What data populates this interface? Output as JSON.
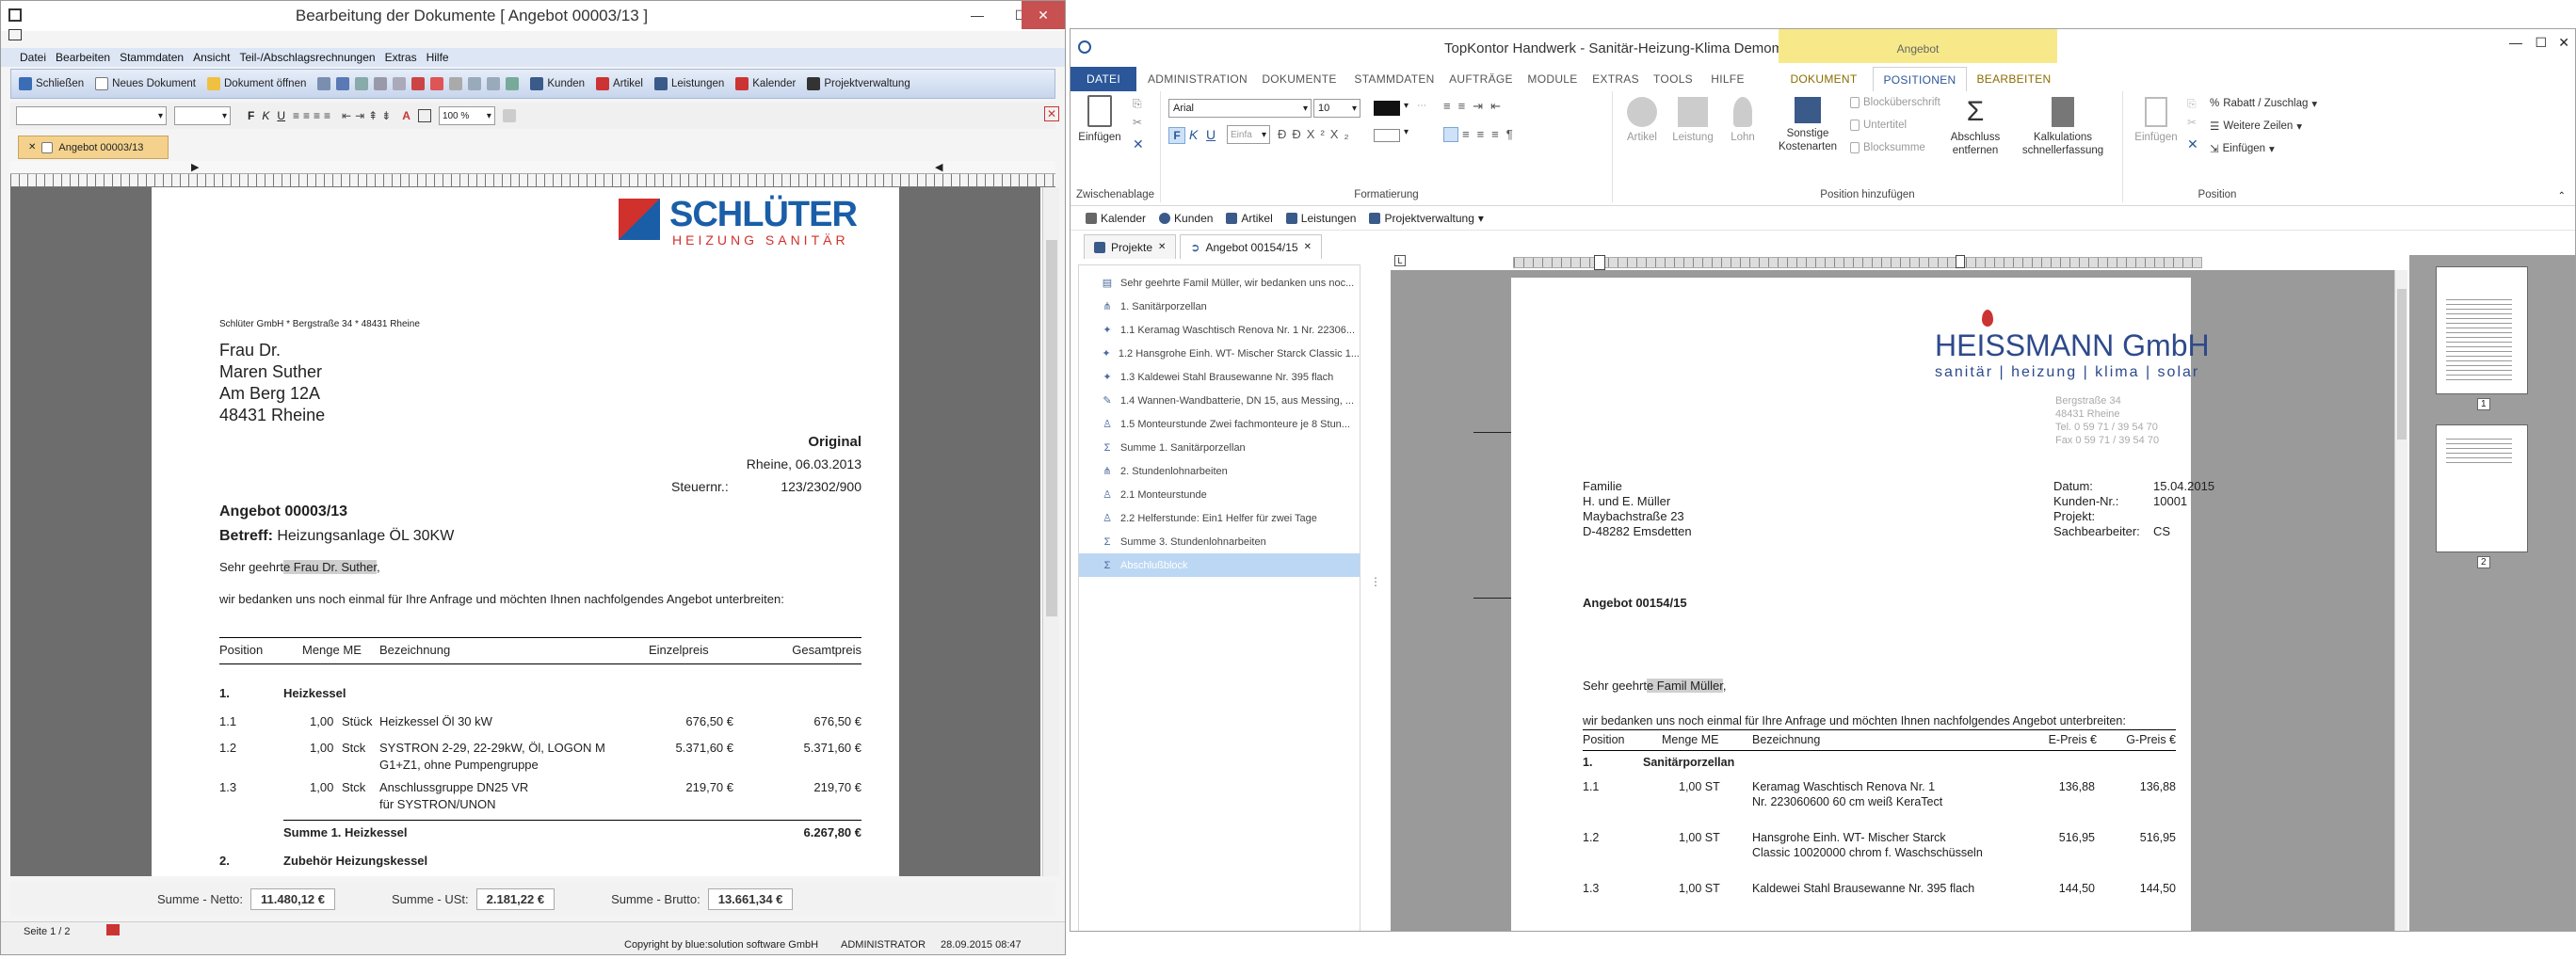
{
  "left_window": {
    "title": "Bearbeitung der Dokumente [ Angebot 00003/13 ]",
    "window_controls": {
      "minimize": "—",
      "maximize": "☐",
      "close": "✕"
    },
    "menu": [
      "Datei",
      "Bearbeiten",
      "Stammdaten",
      "Ansicht",
      "Teil-/Abschlagsrechnungen",
      "Extras",
      "Hilfe"
    ],
    "toolbar": {
      "close": "Schließen",
      "new_doc": "Neues Dokument",
      "open_doc": "Dokument öffnen",
      "customers": "Kunden",
      "articles": "Artikel",
      "services": "Leistungen",
      "calendar": "Kalender",
      "projects": "Projektverwaltung"
    },
    "format_bar": {
      "bold": "F",
      "italic": "K",
      "underline": "U",
      "zoom": "100 %"
    },
    "doc_tab": "Angebot 00003/13",
    "document": {
      "logo_name": "SCHLÜTER",
      "logo_sub": "HEIZUNG SANITÄR",
      "sender_line": "Schlüter GmbH * Bergstraße 34 * 48431 Rheine",
      "address": [
        "Frau Dr.",
        "Maren Suther",
        "Am Berg 12A",
        "48431 Rheine"
      ],
      "original_label": "Original",
      "place_date": "Rheine, 06.03.2013",
      "tax_label": "Steuernr.:",
      "tax_no": "123/2302/900",
      "subject_title": "Angebot 00003/13",
      "betreff_label": "Betreff:",
      "betreff_text": "Heizungsanlage ÖL 30KW",
      "salutation_prefix": "Sehr geehrt",
      "salutation_name": "e Frau Dr. Suther",
      "salutation_suffix": ",",
      "intro": "wir bedanken uns noch einmal für Ihre Anfrage und möchten Ihnen nachfolgendes Angebot unterbreiten:",
      "table_headers": [
        "Position",
        "Menge ME",
        "Bezeichnung",
        "Einzelpreis",
        "Gesamtpreis"
      ],
      "sections": [
        {
          "pos": "1.",
          "name": "Heizkessel"
        },
        {
          "pos": "2.",
          "name": "Zubehör Heizungskessel"
        }
      ],
      "rows": [
        {
          "pos": "1.1",
          "qty": "1,00",
          "unit": "Stück",
          "desc": "Heizkessel Öl 30 kW",
          "desc2": "",
          "price": "676,50 €",
          "total": "676,50 €"
        },
        {
          "pos": "1.2",
          "qty": "1,00",
          "unit": "Stck",
          "desc": "SYSTRON 2-29, 22-29kW, Öl, LOGON M",
          "desc2": "G1+Z1, ohne Pumpengruppe",
          "price": "5.371,60 €",
          "total": "5.371,60 €"
        },
        {
          "pos": "1.3",
          "qty": "1,00",
          "unit": "Stck",
          "desc": "Anschlussgruppe DN25 VR",
          "desc2": "für SYSTRON/UNON",
          "price": "219,70 €",
          "total": "219,70 €"
        }
      ],
      "sum_label": "Summe 1. Heizkessel",
      "sum_value": "6.267,80 €"
    },
    "sums": {
      "net_label": "Summe - Netto:",
      "net": "11.480,12 €",
      "vat_label": "Summe - USt:",
      "vat": "2.181,22 €",
      "gross_label": "Summe - Brutto:",
      "gross": "13.661,34 €"
    },
    "status": {
      "page": "Seite 1 / 2",
      "copyright": "Copyright by blue:solution software GmbH",
      "user": "ADMINISTRATOR",
      "datetime": "28.09.2015 08:47"
    }
  },
  "right_window": {
    "title": "TopKontor Handwerk -  Sanitär-Heizung-Klima Demomandant",
    "context_group": "Angebot",
    "window_controls": {
      "minimize": "—",
      "maximize": "☐",
      "close": "✕"
    },
    "tabs": [
      "DATEI",
      "ADMINISTRATION",
      "DOKUMENTE",
      "STAMMDATEN",
      "AUFTRÄGE",
      "MODULE",
      "EXTRAS",
      "TOOLS",
      "HILFE",
      "DOKUMENT",
      "POSITIONEN",
      "BEARBEITEN"
    ],
    "ribbon": {
      "clipboard": {
        "paste": "Einfügen",
        "label": "Zwischenablage"
      },
      "format": {
        "font": "Arial",
        "size": "10",
        "label": "Formatierung",
        "bold": "F",
        "italic": "K",
        "underline": "U",
        "size_box": "Einfa"
      },
      "add_position": {
        "label": "Position hinzufügen",
        "article": "Artikel",
        "service": "Leistung",
        "wage": "Lohn",
        "other_costs": "Sonstige Kostenarten",
        "block_header": "Blocküberschrift",
        "subtitle": "Untertitel",
        "block_sum": "Blocksumme",
        "remove_closing": "Abschluss entfernen",
        "quick_calc": "Kalkulations schnellerfassung"
      },
      "position": {
        "label": "Position",
        "paste": "Einfügen",
        "discount": "Rabatt / Zuschlag",
        "add_rows": "Weitere Zeilen",
        "insert": "Einfügen"
      }
    },
    "quickbar": [
      "Kalender",
      "Kunden",
      "Artikel",
      "Leistungen",
      "Projektverwaltung"
    ],
    "doc_tabs": [
      "Projekte",
      "Angebot 00154/15"
    ],
    "tree": [
      {
        "icon": "doc",
        "text": "Sehr geehrte Famil Müller,  wir bedanken uns noc..."
      },
      {
        "icon": "group",
        "text": "1. Sanitärporzellan"
      },
      {
        "icon": "pin",
        "text": "1.1 Keramag Waschtisch Renova Nr. 1 Nr. 22306..."
      },
      {
        "icon": "pin",
        "text": "1.2 Hansgrohe Einh. WT- Mischer Starck Classic 1..."
      },
      {
        "icon": "pin",
        "text": "1.3 Kaldewei Stahl Brausewanne Nr. 395 flach"
      },
      {
        "icon": "tool",
        "text": "1.4 Wannen-Wandbatterie, DN 15, aus Messing, ..."
      },
      {
        "icon": "person",
        "text": "1.5 Monteurstunde Zwei fachmonteure je 8 Stun..."
      },
      {
        "icon": "sigma",
        "text": "Summe 1. Sanitärporzellan"
      },
      {
        "icon": "group",
        "text": "2. Stundenlohnarbeiten"
      },
      {
        "icon": "person",
        "text": "2.1 Monteurstunde"
      },
      {
        "icon": "person",
        "text": "2.2 Helferstunde: Ein1 Helfer für zwei Tage"
      },
      {
        "icon": "sigma",
        "text": "Summe 3. Stundenlohnarbeiten"
      },
      {
        "icon": "sigma",
        "text": "Abschlußblock"
      }
    ],
    "document": {
      "logo_name": "HEISSMANN GmbH",
      "logo_sub": "sanitär | heizung | klima | solar",
      "company_addr": [
        "Bergstraße 34",
        "48431 Rheine",
        "Tel. 0 59 71 / 39 54 70",
        "Fax 0 59 71 / 39 54 70"
      ],
      "recipient": [
        "Familie",
        "H. und E. Müller",
        "Maybachstraße 23",
        "D-48282 Emsdetten"
      ],
      "meta_labels": [
        "Datum:",
        "Kunden-Nr.:",
        "Projekt:",
        "Sachbearbeiter:"
      ],
      "meta_values": [
        "15.04.2015",
        "10001",
        "",
        "CS"
      ],
      "title": "Angebot 00154/15",
      "salutation_prefix": "Sehr geehrt",
      "salutation_name": "e Famil Müller",
      "salutation_suffix": ",",
      "intro": "wir bedanken uns noch einmal für Ihre Anfrage und möchten Ihnen nachfolgendes Angebot unterbreiten:",
      "headers": [
        "Position",
        "Menge ME",
        "Bezeichnung",
        "E-Preis €",
        "G-Preis €"
      ],
      "section": {
        "pos": "1.",
        "name": "Sanitärporzellan"
      },
      "rows": [
        {
          "pos": "1.1",
          "qty": "1,00 ST",
          "desc": "Keramag Waschtisch Renova Nr. 1",
          "desc2": "Nr. 223060600 60 cm weiß KeraTect",
          "eprice": "136,88",
          "gprice": "136,88"
        },
        {
          "pos": "1.2",
          "qty": "1,00 ST",
          "desc": "Hansgrohe Einh. WT- Mischer Starck",
          "desc2": "Classic 10020000 chrom f. Waschschüsseln",
          "eprice": "516,95",
          "gprice": "516,95"
        },
        {
          "pos": "1.3",
          "qty": "1,00 ST",
          "desc": "Kaldewei Stahl Brausewanne Nr. 395 flach",
          "desc2": "",
          "eprice": "144,50",
          "gprice": "144,50"
        }
      ]
    },
    "thumbnails": [
      "1",
      "2"
    ]
  },
  "colors": {
    "accent_blue": "#2b579a",
    "schlueter_blue": "#1a5ea8",
    "schlueter_red": "#d0312d",
    "heissmann_blue": "#2e4a8c",
    "context_yellow": "#f7e98a",
    "close_red": "#c75050",
    "doc_tab_orange": "#f4d28d"
  }
}
